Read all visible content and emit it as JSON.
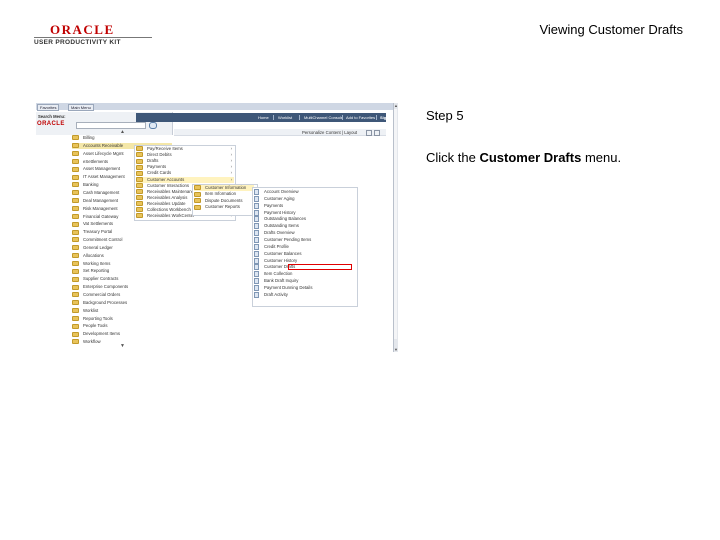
{
  "header": {
    "logo_oracle": "ORACLE",
    "logo_subtitle": "USER PRODUCTIVITY KIT",
    "page_title": "Viewing Customer Drafts"
  },
  "instruction": {
    "step": "Step 5",
    "prefix": "Click the ",
    "target": "Customer Drafts",
    "suffix": " menu."
  },
  "screenshot": {
    "nav_tabs": [
      "Favorites",
      "Main Menu"
    ],
    "top_links": [
      "Home",
      "Worklist",
      "MultiChannel Console",
      "Add to Favorites",
      "Sign out"
    ],
    "logo": "ORACLE",
    "search_label": "Search Menu:",
    "right_header": "Personalize Content | Layout",
    "menu_level1": [
      "Billing",
      "Accounts Receivable",
      "Asset Lifecycle Mgmt",
      "eSettlements",
      "Asset Management",
      "IT Asset Management",
      "Banking",
      "Cash Management",
      "Deal Management",
      "Risk Management",
      "Financial Gateway",
      "Vat Settlements",
      "Treasury Portal",
      "Commitment Control",
      "General Ledger",
      "Allocations",
      "Working Items",
      "Set Reporting",
      "Supplier Contracts",
      "Enterprise Components",
      "Commercial Orders",
      "Background Processes",
      "Worklist",
      "Reporting Tools",
      "People Tools",
      "Development Items",
      "Workflow"
    ],
    "menu_level2": [
      "Pay/Receive Items",
      "Direct Debits",
      "Drafts",
      "Payments",
      "Credit Cards",
      "Customer Accounts",
      "Customer Interactions",
      "Receivables Maintenance",
      "Receivables Analysis",
      "Receivables Update",
      "Collections Workbench",
      "Receivables WorkCenter"
    ],
    "menu_level3": [
      "Customer Information",
      "Item Information",
      "Dispute Documents",
      "Customer Reports"
    ],
    "menu_level4": [
      "Account Overview",
      "Customer Aging",
      "Payments",
      "Payment History",
      "Outstanding Balances",
      "Outstanding Items",
      "Drafts Overview",
      "Customer Pending Items",
      "Credit Profile",
      "Customer Balances",
      "Customer History",
      "Customer Drafts",
      "Item Collection",
      "Bank Draft Inquiry",
      "Payment Dunning Details",
      "Draft Activity"
    ]
  }
}
